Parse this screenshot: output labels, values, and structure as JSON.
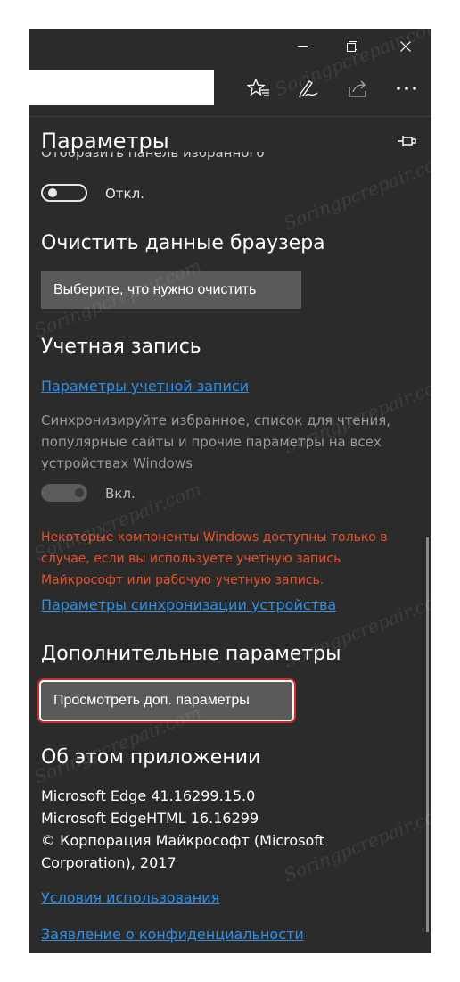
{
  "panel": {
    "title": "Параметры"
  },
  "cut_text": "Отобразить панель избранного",
  "favorites_toggle": {
    "label": "Откл."
  },
  "clear_data": {
    "heading": "Очистить данные браузера",
    "button": "Выберите, что нужно очистить"
  },
  "account": {
    "heading": "Учетная запись",
    "settings_link": "Параметры учетной записи",
    "sync_desc": "Синхронизируйте избранное, список для чтения, популярные сайты и прочие параметры на всех устройствах Windows",
    "sync_toggle_label": "Вкл.",
    "warning": "Некоторые компоненты Windows доступны только в случае, если вы используете учетную запись Майкрософт или рабочую учетную запись.",
    "sync_settings_link": "Параметры синхронизации устройства"
  },
  "advanced": {
    "heading": "Дополнительные параметры",
    "button": "Просмотреть доп. параметры"
  },
  "about": {
    "heading": "Об этом приложении",
    "line1": "Microsoft Edge 41.16299.15.0",
    "line2": "Microsoft EdgeHTML 16.16299",
    "line3": "© Корпорация Майкрософт (Microsoft",
    "line4": "Corporation), 2017",
    "terms_link": "Условия использования",
    "privacy_link": "Заявление о конфиденциальности"
  },
  "watermark": "Soringpcrepair.com",
  "icons": {
    "minimize": "minimize-icon",
    "maximize": "restore-icon",
    "close": "close-icon",
    "favorites": "favorites-star-icon",
    "notes": "pen-icon",
    "share": "share-icon",
    "more": "more-icon",
    "pin": "pin-icon"
  },
  "colors": {
    "background": "#2b2b2b",
    "link": "#2f8fe6",
    "warning": "#e8512c",
    "highlight": "#d12a2a"
  }
}
